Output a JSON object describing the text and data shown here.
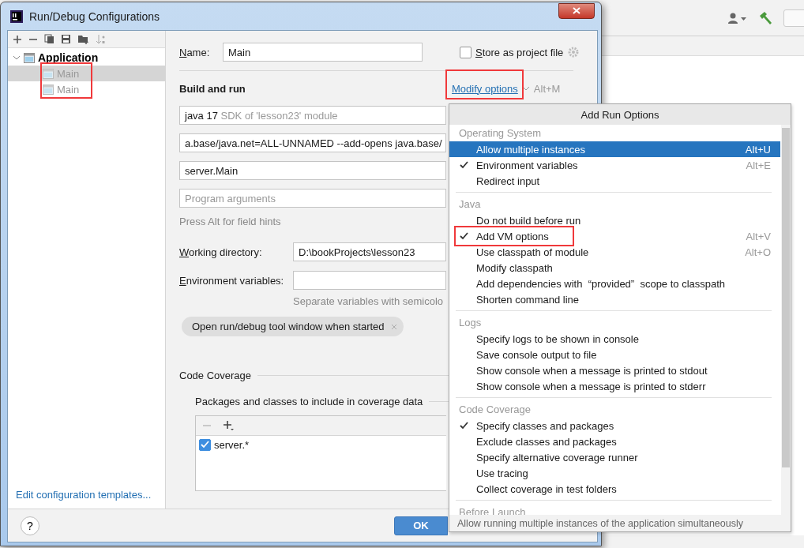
{
  "dialog": {
    "title": "Run/Debug Configurations",
    "tree": [
      {
        "label": "Application",
        "expanded": true,
        "children_annotated": true,
        "children": [
          {
            "label": "Main",
            "selected": true
          },
          {
            "label": "Main",
            "selected": false
          }
        ]
      }
    ],
    "templates_link": "Edit configuration templates...",
    "name_label": "Name:",
    "name_value": "Main",
    "store_label": "Store as project file",
    "store_checked": false,
    "section_title": "Build and run",
    "modify_options": {
      "label": "Modify options",
      "shortcut": "Alt+M",
      "annotated": true
    },
    "sdk_field": {
      "value": "java 17",
      "hint": "SDK of 'lesson23' module"
    },
    "vm_field": {
      "value": "a.base/java.net=ALL-UNNAMED --add-opens java.base/"
    },
    "class_field": {
      "value": "server.Main"
    },
    "args_field": {
      "placeholder": "Program arguments"
    },
    "field_hint": "Press Alt for field hints",
    "working_dir": {
      "label": "Working directory:",
      "value": "D:\\bookProjects\\lesson23"
    },
    "env_vars": {
      "label": "Environment variables:",
      "hint": "Separate variables with semicolo"
    },
    "chip": "Open run/debug tool window when started",
    "coverage_title": "Code Coverage",
    "packages_label": "Packages and classes to include in coverage data",
    "packages": [
      {
        "label": "server.*",
        "checked": true
      }
    ],
    "ok_button": "OK",
    "help_button": "?"
  },
  "popup": {
    "title": "Add Run Options",
    "sections": [
      {
        "title": "Operating System",
        "items": [
          {
            "label": "Allow multiple instances",
            "shortcut": "Alt+U",
            "checked": false,
            "selected": true
          },
          {
            "label": "Environment variables",
            "shortcut": "Alt+E",
            "checked": true,
            "selected": false
          },
          {
            "label": "Redirect input",
            "checked": false,
            "selected": false
          }
        ]
      },
      {
        "title": "Java",
        "items": [
          {
            "label": "Do not build before run",
            "checked": false,
            "selected": false
          },
          {
            "label": "Add VM options",
            "shortcut": "Alt+V",
            "checked": true,
            "selected": false,
            "annotated": true
          },
          {
            "label": "Use classpath of module",
            "shortcut": "Alt+O",
            "checked": false,
            "selected": false
          },
          {
            "label": "Modify classpath",
            "checked": false,
            "selected": false
          },
          {
            "label": "Add dependencies with  “provided”  scope to classpath",
            "checked": false,
            "selected": false
          },
          {
            "label": "Shorten command line",
            "checked": false,
            "selected": false
          }
        ]
      },
      {
        "title": "Logs",
        "items": [
          {
            "label": "Specify logs to be shown in console",
            "checked": false,
            "selected": false
          },
          {
            "label": "Save console output to file",
            "checked": false,
            "selected": false
          },
          {
            "label": "Show console when a message is printed to stdout",
            "checked": false,
            "selected": false
          },
          {
            "label": "Show console when a message is printed to stderr",
            "checked": false,
            "selected": false
          }
        ]
      },
      {
        "title": "Code Coverage",
        "items": [
          {
            "label": "Specify classes and packages",
            "checked": true,
            "selected": false
          },
          {
            "label": "Exclude classes and packages",
            "checked": false,
            "selected": false
          },
          {
            "label": "Specify alternative coverage runner",
            "checked": false,
            "selected": false
          },
          {
            "label": "Use tracing",
            "checked": false,
            "selected": false
          },
          {
            "label": "Collect coverage in test folders",
            "checked": false,
            "selected": false
          }
        ]
      },
      {
        "title": "Before Launch"
      }
    ],
    "footer": "Allow running multiple instances of the application simultaneously"
  }
}
